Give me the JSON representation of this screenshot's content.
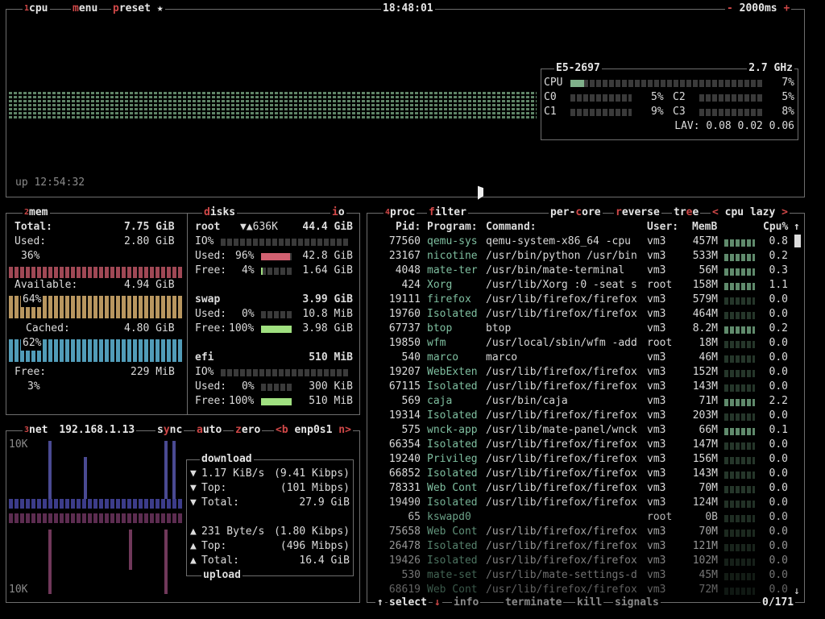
{
  "cpu": {
    "title_label": "cpu",
    "menu_label": "menu",
    "preset_label": "preset ★",
    "clock": "18:48:01",
    "interval": "2000ms",
    "minus": "-",
    "plus": "+",
    "uptime": "up 12:54:32",
    "model": "E5-2697",
    "freq": "2.7 GHz",
    "total_label": "CPU",
    "total_pct": "7%",
    "total_value": 0.07,
    "cores": [
      {
        "label": "C0",
        "pct": "5%",
        "value": 0.05
      },
      {
        "label": "C1",
        "pct": "9%",
        "value": 0.09
      },
      {
        "label": "C2",
        "pct": "5%",
        "value": 0.05
      },
      {
        "label": "C3",
        "pct": "8%",
        "value": 0.08
      }
    ],
    "load_avg": "LAV: 0.08 0.02 0.06"
  },
  "mem": {
    "title": "mem",
    "total_label": "Total:",
    "total_value": "7.75 GiB",
    "used_label": "Used:",
    "used_value": "2.80 GiB",
    "used_pct": "36%",
    "avail_label": "Available:",
    "avail_value": "4.94 GiB",
    "avail_pct": "64%",
    "cached_label": "Cached:",
    "cached_value": "4.80 GiB",
    "cached_pct": "62%",
    "free_label": "Free:",
    "free_value": "229 MiB",
    "free_pct": "3%"
  },
  "disks": {
    "title": "disks",
    "io_label": "io",
    "groups": [
      {
        "name": "root",
        "rate": "▼▲636K",
        "size": "44.4 GiB",
        "io_label": "IO%",
        "used_label": "Used:",
        "used_pct": "96%",
        "used_value": "42.8 GiB",
        "used_fill": 0.96,
        "free_label": "Free:",
        "free_pct": "4%",
        "free_value": "1.64 GiB",
        "free_fill": 0.04
      },
      {
        "name": "swap",
        "rate": "",
        "size": "3.99 GiB",
        "io_label": "",
        "used_label": "Used:",
        "used_pct": "0%",
        "used_value": "10.8 MiB",
        "used_fill": 0.0,
        "free_label": "Free:",
        "free_pct": "100%",
        "free_value": "3.98 GiB",
        "free_fill": 1.0
      },
      {
        "name": "efi",
        "rate": "",
        "size": "510 MiB",
        "io_label": "IO%",
        "used_label": "Used:",
        "used_pct": "0%",
        "used_value": "300 KiB",
        "used_fill": 0.0,
        "free_label": "Free:",
        "free_pct": "100%",
        "free_value": "510 MiB",
        "free_fill": 1.0
      }
    ]
  },
  "net": {
    "title": "net",
    "ip": "192.168.1.13",
    "sync": "sync",
    "auto": "auto",
    "zero": "zero",
    "prev": "<b",
    "iface": "enp0s1",
    "next": "n>",
    "scale_top": "10K",
    "scale_bottom": "10K",
    "download_label": "download",
    "upload_label": "upload",
    "down_rate": "1.17 KiB/s",
    "down_rate_bits": "(9.41 Kibps)",
    "down_top_label": "Top:",
    "down_top": "(101 Mibps)",
    "down_total_label": "Total:",
    "down_total": "27.9 GiB",
    "up_rate": "231 Byte/s",
    "up_rate_bits": "(1.80 Kibps)",
    "up_top_label": "Top:",
    "up_top": "(496 Mibps)",
    "up_total_label": "Total:",
    "up_total": "16.4 GiB"
  },
  "proc": {
    "title": "proc",
    "filter": "filter",
    "per_core": "per-core",
    "reverse": "reverse",
    "tree": "tree",
    "sort_prev": "<",
    "sort_field": "cpu lazy",
    "sort_next": ">",
    "headers": {
      "pid": "Pid:",
      "program": "Program:",
      "command": "Command:",
      "user": "User:",
      "mem": "MemB",
      "cpu": "Cpu%"
    },
    "rows": [
      {
        "pid": "77560",
        "program": "qemu-sys",
        "command": "qemu-system-x86_64 -cpu",
        "user": "vm3",
        "mem": "457M",
        "cpu": "0.8"
      },
      {
        "pid": "23167",
        "program": "nicotine",
        "command": "/usr/bin/python /usr/bin",
        "user": "vm3",
        "mem": "533M",
        "cpu": "0.2"
      },
      {
        "pid": "4048",
        "program": "mate-ter",
        "command": "/usr/bin/mate-terminal",
        "user": "vm3",
        "mem": "56M",
        "cpu": "0.3"
      },
      {
        "pid": "424",
        "program": "Xorg",
        "command": "/usr/lib/Xorg :0 -seat s",
        "user": "root",
        "mem": "158M",
        "cpu": "1.1"
      },
      {
        "pid": "19111",
        "program": "firefox",
        "command": "/usr/lib/firefox/firefox",
        "user": "vm3",
        "mem": "579M",
        "cpu": "0.0"
      },
      {
        "pid": "19760",
        "program": "Isolated",
        "command": "/usr/lib/firefox/firefox",
        "user": "vm3",
        "mem": "464M",
        "cpu": "0.0"
      },
      {
        "pid": "67737",
        "program": "btop",
        "command": "btop",
        "user": "vm3",
        "mem": "8.2M",
        "cpu": "0.2"
      },
      {
        "pid": "19850",
        "program": "wfm",
        "command": "/usr/local/sbin/wfm -add",
        "user": "root",
        "mem": "18M",
        "cpu": "0.0"
      },
      {
        "pid": "540",
        "program": "marco",
        "command": "marco",
        "user": "vm3",
        "mem": "46M",
        "cpu": "0.0"
      },
      {
        "pid": "19207",
        "program": "WebExten",
        "command": "/usr/lib/firefox/firefox",
        "user": "vm3",
        "mem": "152M",
        "cpu": "0.0"
      },
      {
        "pid": "67115",
        "program": "Isolated",
        "command": "/usr/lib/firefox/firefox",
        "user": "vm3",
        "mem": "143M",
        "cpu": "0.0"
      },
      {
        "pid": "569",
        "program": "caja",
        "command": "/usr/bin/caja",
        "user": "vm3",
        "mem": "71M",
        "cpu": "2.2"
      },
      {
        "pid": "19314",
        "program": "Isolated",
        "command": "/usr/lib/firefox/firefox",
        "user": "vm3",
        "mem": "203M",
        "cpu": "0.0"
      },
      {
        "pid": "575",
        "program": "wnck-app",
        "command": "/usr/lib/mate-panel/wnck",
        "user": "vm3",
        "mem": "66M",
        "cpu": "0.1"
      },
      {
        "pid": "66354",
        "program": "Isolated",
        "command": "/usr/lib/firefox/firefox",
        "user": "vm3",
        "mem": "147M",
        "cpu": "0.0"
      },
      {
        "pid": "19240",
        "program": "Privileg",
        "command": "/usr/lib/firefox/firefox",
        "user": "vm3",
        "mem": "156M",
        "cpu": "0.0"
      },
      {
        "pid": "66852",
        "program": "Isolated",
        "command": "/usr/lib/firefox/firefox",
        "user": "vm3",
        "mem": "143M",
        "cpu": "0.0"
      },
      {
        "pid": "78331",
        "program": "Web Cont",
        "command": "/usr/lib/firefox/firefox",
        "user": "vm3",
        "mem": "70M",
        "cpu": "0.0"
      },
      {
        "pid": "19490",
        "program": "Isolated",
        "command": "/usr/lib/firefox/firefox",
        "user": "vm3",
        "mem": "124M",
        "cpu": "0.0"
      },
      {
        "pid": "65",
        "program": "kswapd0",
        "command": "",
        "user": "root",
        "mem": "0B",
        "cpu": "0.0"
      },
      {
        "pid": "75658",
        "program": "Web Cont",
        "command": "/usr/lib/firefox/firefox",
        "user": "vm3",
        "mem": "70M",
        "cpu": "0.0"
      },
      {
        "pid": "26478",
        "program": "Isolated",
        "command": "/usr/lib/firefox/firefox",
        "user": "vm3",
        "mem": "121M",
        "cpu": "0.0"
      },
      {
        "pid": "19426",
        "program": "Isolated",
        "command": "/usr/lib/firefox/firefox",
        "user": "vm3",
        "mem": "102M",
        "cpu": "0.0"
      },
      {
        "pid": "530",
        "program": "mate-set",
        "command": "/usr/lib/mate-settings-d",
        "user": "vm3",
        "mem": "45M",
        "cpu": "0.0"
      },
      {
        "pid": "68619",
        "program": "Web Cont",
        "command": "/usr/lib/firefox/firefox",
        "user": "vm3",
        "mem": "72M",
        "cpu": "0.0"
      }
    ],
    "footer": {
      "up_arrow": "↑",
      "select": "select",
      "down_arrow": "↓",
      "info": "info",
      "terminate": "terminate",
      "kill": "kill",
      "signals": "signals",
      "count": "0/171"
    }
  },
  "colors": {
    "border": "#6e6e6e",
    "accent_red": "#d04848",
    "cpu_graph": "#7fb08a",
    "mem_used": "#c85a6a",
    "mem_avail": "#d8b070",
    "mem_cached": "#5fb8d8",
    "mem_free": "#70b890"
  }
}
